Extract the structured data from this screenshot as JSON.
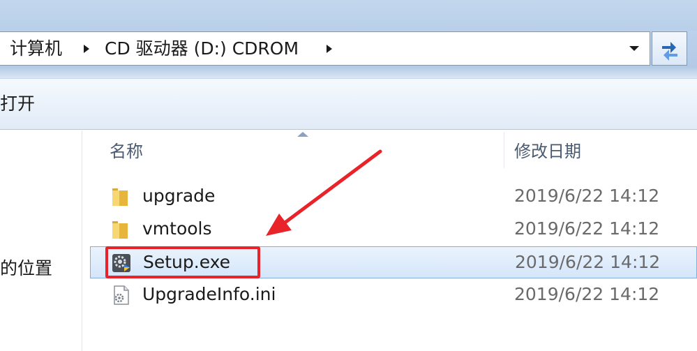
{
  "address_bar": {
    "crumbs": [
      "计算机",
      "CD 驱动器 (D:) CDROM"
    ]
  },
  "toolbar": {
    "open_label": "打开"
  },
  "nav_pane": {
    "partial_item": "的位置"
  },
  "columns": {
    "name": "名称",
    "date_modified": "修改日期"
  },
  "files": [
    {
      "name": "upgrade",
      "date": "2019/6/22 14:12",
      "type": "folder-icon",
      "selected": false
    },
    {
      "name": "vmtools",
      "date": "2019/6/22 14:12",
      "type": "folder-icon",
      "selected": false
    },
    {
      "name": "Setup.exe",
      "date": "2019/6/22 14:12",
      "type": "setup-exe-icon",
      "selected": true
    },
    {
      "name": "UpgradeInfo.ini",
      "date": "2019/6/22 14:12",
      "type": "ini-file-icon",
      "selected": false
    }
  ],
  "colors": {
    "annotation_red": "#e8232a",
    "selection_border": "#84acdd"
  }
}
